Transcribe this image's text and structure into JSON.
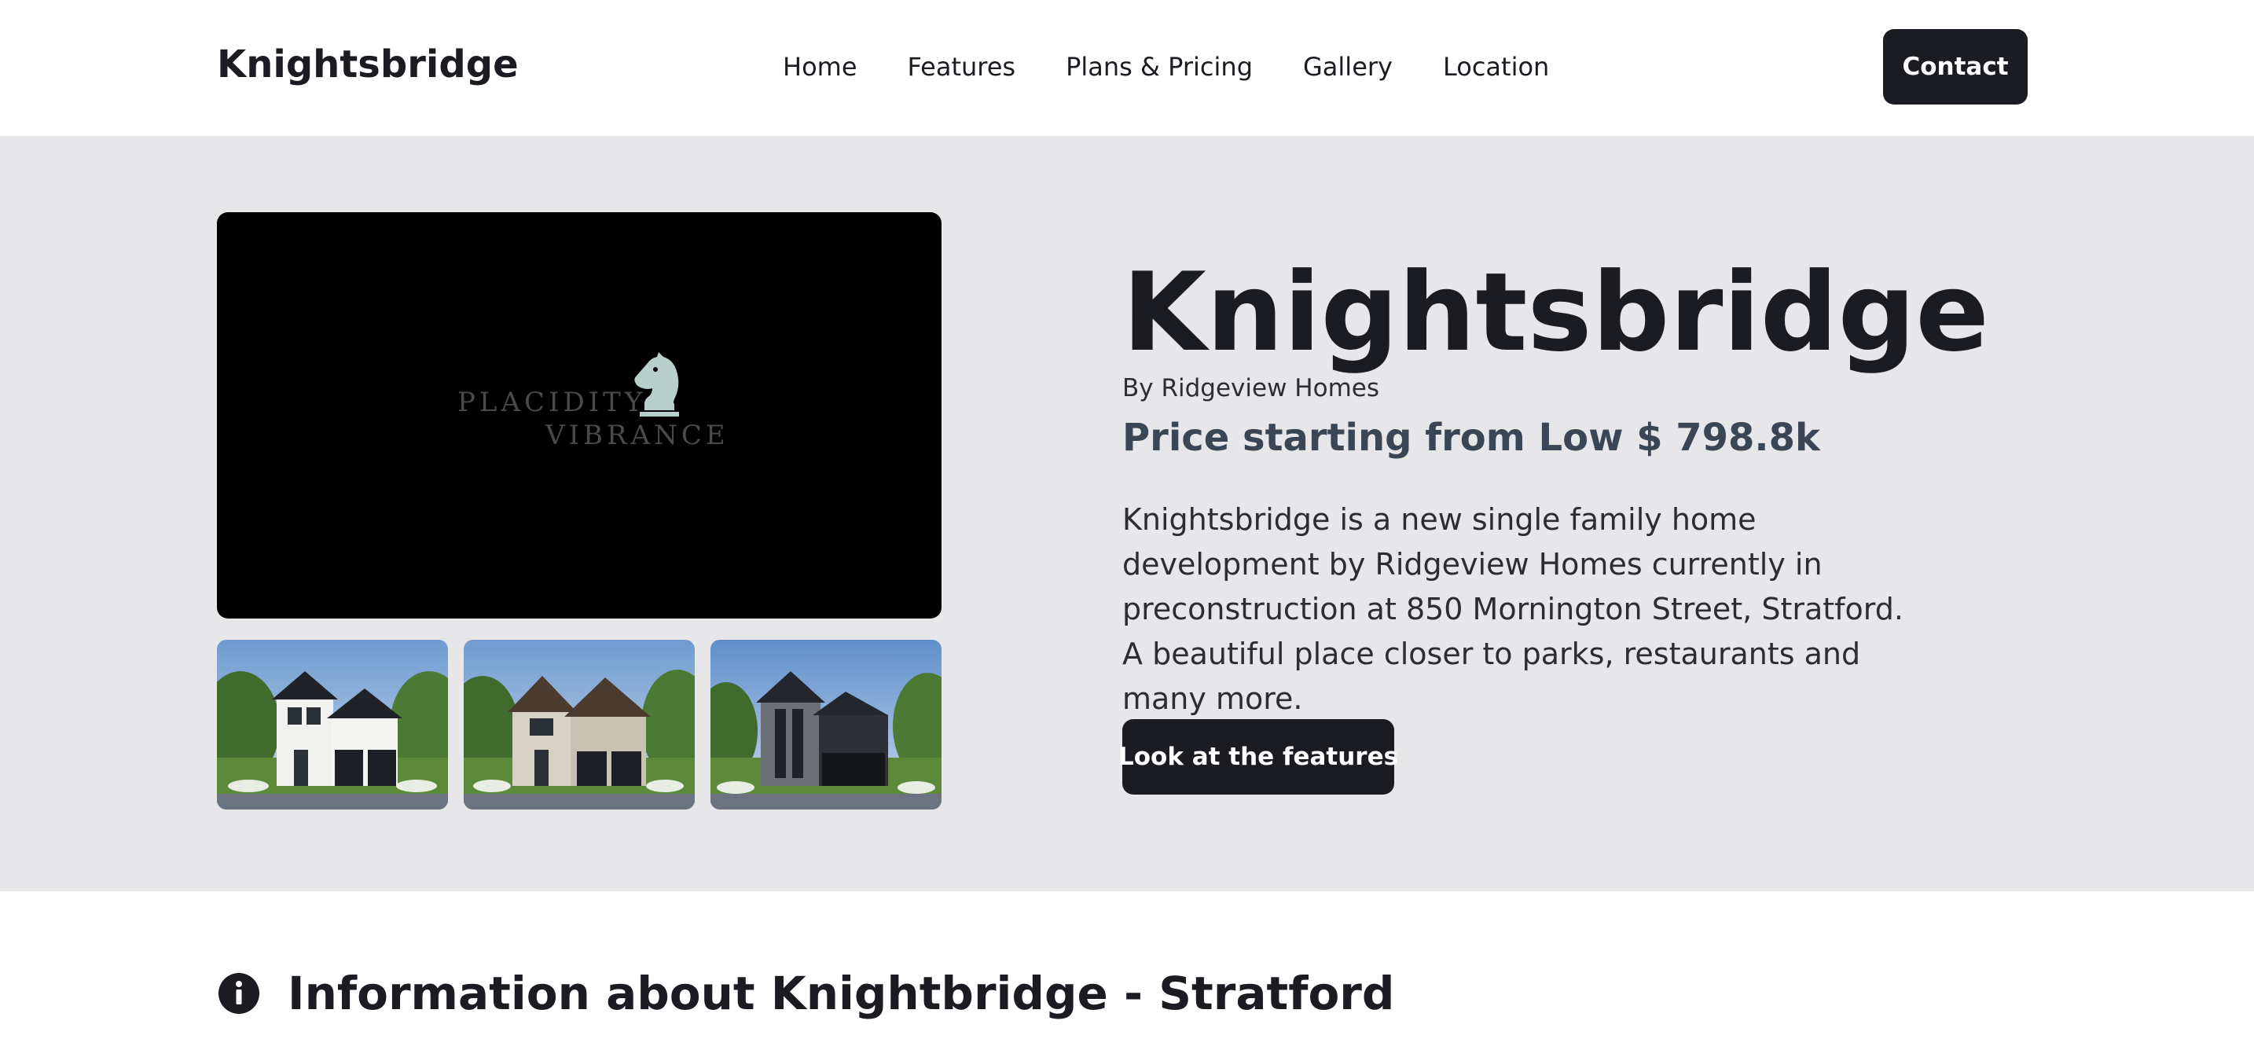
{
  "header": {
    "brand": "Knightsbridge",
    "nav": [
      {
        "label": "Home"
      },
      {
        "label": "Features"
      },
      {
        "label": "Plans & Pricing"
      },
      {
        "label": "Gallery"
      },
      {
        "label": "Location"
      }
    ],
    "contact_label": "Contact"
  },
  "hero": {
    "video": {
      "logo_line1": "PLACIDITY",
      "logo_line2": "VIBRANCE",
      "logo_icon": "chess-knight-icon"
    },
    "thumbnails": [
      {
        "alt": "house-render-white-modern"
      },
      {
        "alt": "house-render-stone-traditional"
      },
      {
        "alt": "house-render-dark-contemporary"
      }
    ],
    "title": "Knightsbridge",
    "byline": "By Ridgeview Homes",
    "price": "Price starting from Low $ 798.8k",
    "description": "Knightsbridge is a new single family home development by Ridgeview Homes currently in preconstruction at 850 Mornington Street, Stratford. A beautiful place closer to parks, restaurants and many more.",
    "cta_label": "Look at the features"
  },
  "info": {
    "icon": "info-icon",
    "title": "Information about Knightbridge - Stratford"
  },
  "colors": {
    "primary_dark": "#1b1c21",
    "hero_bg": "#e7e7e9",
    "price_text": "#3a4656",
    "logo_accent": "#b9cfcb"
  }
}
